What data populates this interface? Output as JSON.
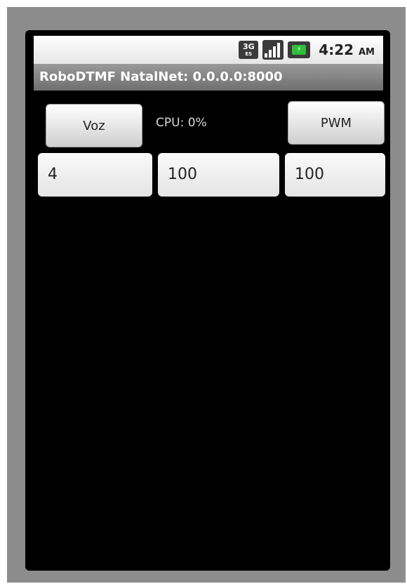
{
  "status_bar": {
    "network_label": "3G",
    "network_sub": "ES",
    "time": "4:22",
    "ampm": "AM",
    "icons": [
      "3g-icon",
      "signal-icon",
      "battery-icon"
    ]
  },
  "title": "RoboDTMF NatalNet: 0.0.0.0:8000",
  "buttons": {
    "voz_label": "Voz",
    "pwm_label": "PWM"
  },
  "cpu_text": "CPU: 0%",
  "fields": {
    "field1_value": "4",
    "field2_value": "100",
    "field3_value": "100"
  },
  "colors": {
    "screen_background": "#000000",
    "title_bar": "#808080",
    "battery_fill": "#2fbf3a"
  }
}
